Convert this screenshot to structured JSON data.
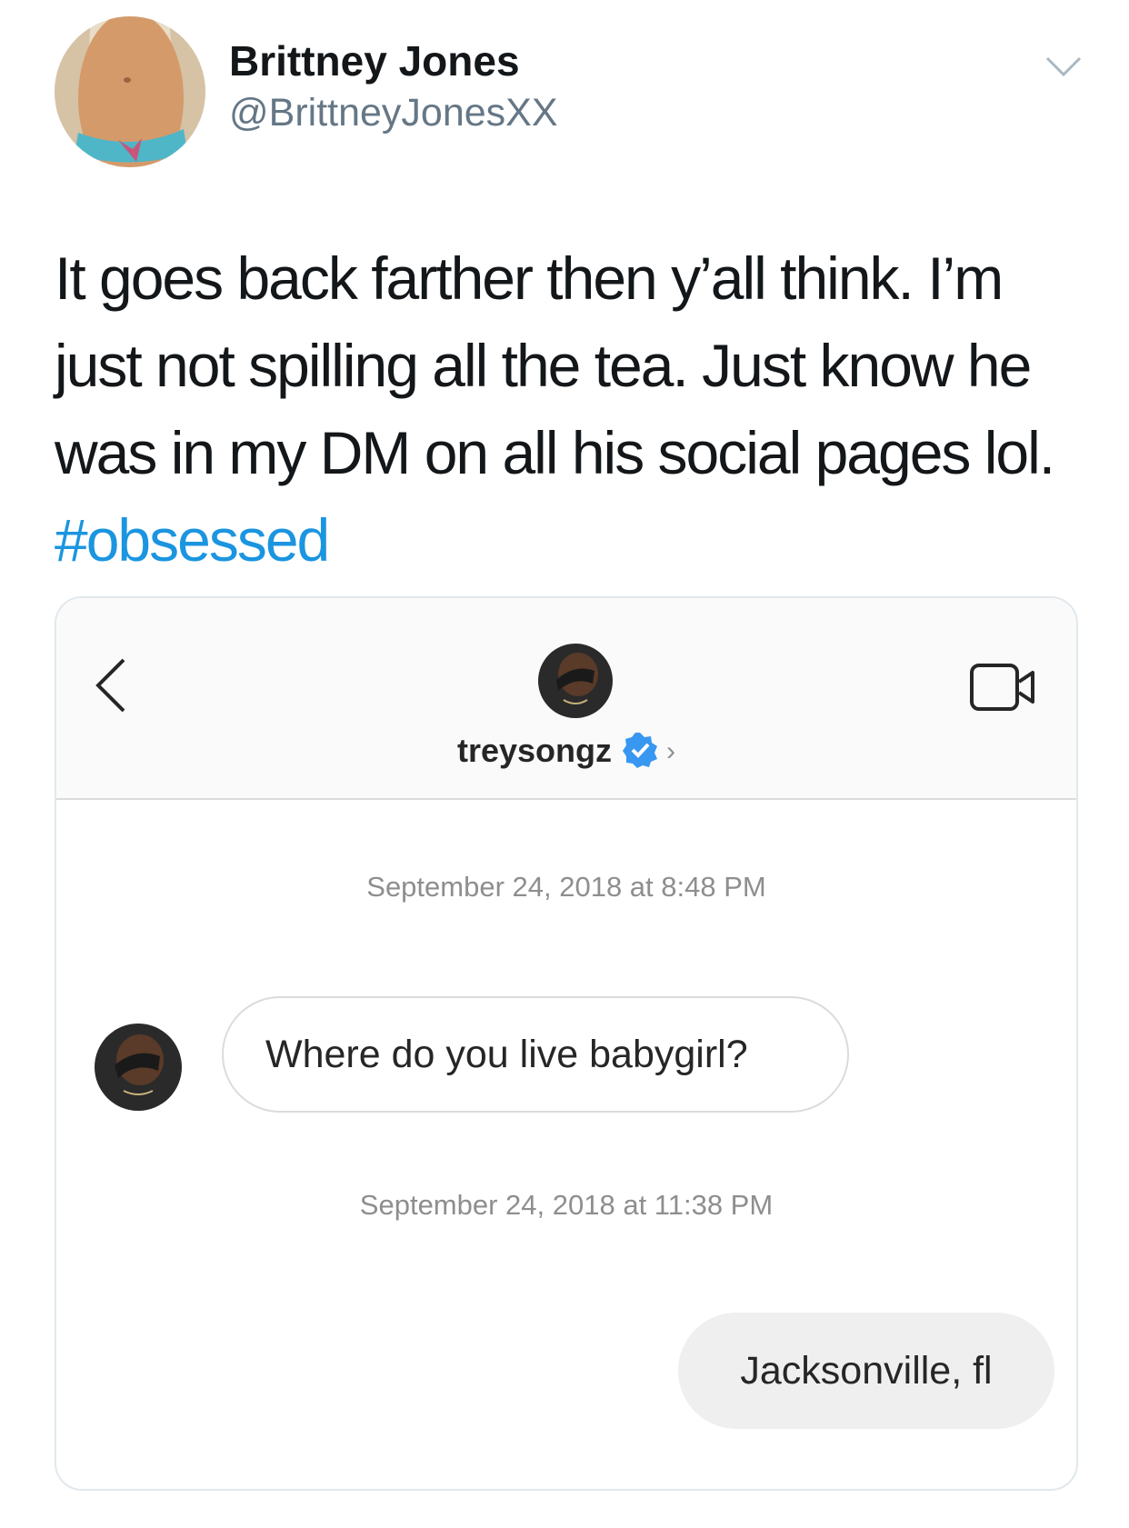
{
  "tweet": {
    "display_name": "Brittney Jones",
    "handle": "@BrittneyJonesXX",
    "text_lines": [
      "It goes back farther then y’all think. I’m",
      "just not spilling all the tea. Just know he",
      "was in my DM on all his social pages lol."
    ],
    "hashtag": "#obsessed",
    "menu_icon": "chevron-down-icon"
  },
  "dm": {
    "username": "treysongz",
    "verified_icon": "verified-badge-icon",
    "timestamps": [
      "September 24, 2018 at 8:48 PM",
      "September 24, 2018 at 11:38 PM"
    ],
    "messages": [
      {
        "direction": "incoming",
        "text": "Where do you live babygirl?"
      },
      {
        "direction": "outgoing",
        "text": "Jacksonville, fl"
      }
    ]
  },
  "colors": {
    "hashtag": "#1b95e0",
    "handle": "#657786",
    "verified": "#3897f0",
    "outgoing_bubble": "#efefef"
  }
}
